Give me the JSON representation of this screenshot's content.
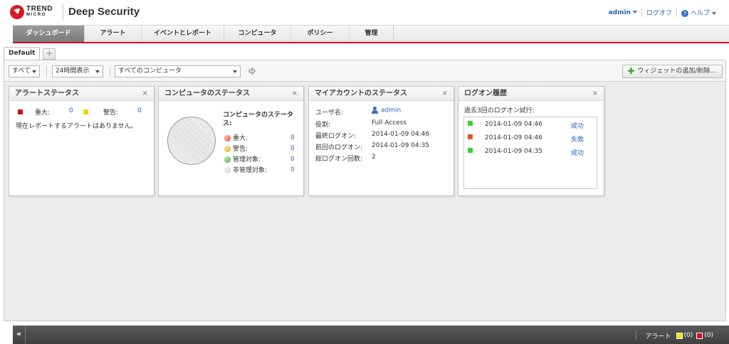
{
  "header": {
    "logo_line1": "TREND",
    "logo_line2": "MICRO",
    "product": "Deep Security",
    "user": "admin",
    "logout": "ログオフ",
    "help": "ヘルプ",
    "help_icon": "?"
  },
  "nav": {
    "tabs": [
      {
        "label": "ダッシュボード",
        "active": true
      },
      {
        "label": "アラート"
      },
      {
        "label": "イベントとレポート"
      },
      {
        "label": "コンピュータ"
      },
      {
        "label": "ポリシー"
      },
      {
        "label": "管理"
      }
    ]
  },
  "dashboard": {
    "tab_label": "Default",
    "add_tab": "+",
    "filter_all": "すべて",
    "time_range": "24時間表示",
    "computer_filter": "すべてのコンピュータ",
    "add_widget_label": "ウィジェットの追加/削除..."
  },
  "widgets": {
    "alert_status": {
      "title": "アラートステータス",
      "critical_label": "重大:",
      "critical_count": "0",
      "warning_label": "警告:",
      "warning_count": "0",
      "message": "現在レポートするアラートはありません。",
      "close": "×"
    },
    "computer_status": {
      "title": "コンピュータのステータス",
      "legend_title": "コンピュータのステータ ス:",
      "items": [
        {
          "label": "重大:",
          "value": "0",
          "color": "#e0452a"
        },
        {
          "label": "警告:",
          "value": "0",
          "color": "#e8a21a"
        },
        {
          "label": "管理対象:",
          "value": "0",
          "color": "#3aa935"
        },
        {
          "label": "非管理対象:",
          "value": "0",
          "color": "#c8c8c8"
        }
      ],
      "close": "×"
    },
    "account_status": {
      "title": "マイアカウントのステータス",
      "rows": [
        {
          "label": "ユーザ名:",
          "value": "admin"
        },
        {
          "label": "役割:",
          "value": "Full Access"
        },
        {
          "label": "最終ログオン:",
          "value": "2014-01-09 04:46"
        },
        {
          "label": "前回のログオン:",
          "value": "2014-01-09 04:35"
        },
        {
          "label": "総ログオン回数:",
          "value": "2"
        }
      ],
      "close": "×"
    },
    "logon_history": {
      "title": "ログオン履歴",
      "subtitle": "過去3回のログオン試行:",
      "entries": [
        {
          "time": "2014-01-09 04:46",
          "result": "成功",
          "color": "#3ccf3c"
        },
        {
          "time": "2014-01-09 04:46",
          "result": "失敗",
          "color": "#e2571e"
        },
        {
          "time": "2014-01-09 04:35",
          "result": "成功",
          "color": "#3ccf3c"
        }
      ],
      "close": "×"
    }
  },
  "bottom_bar": {
    "collapse": "«",
    "alerts_label": "アラート",
    "warning_count": "(0)",
    "critical_count": "(0)",
    "warning_color": "#f2e600",
    "critical_color": "#e0001b"
  }
}
